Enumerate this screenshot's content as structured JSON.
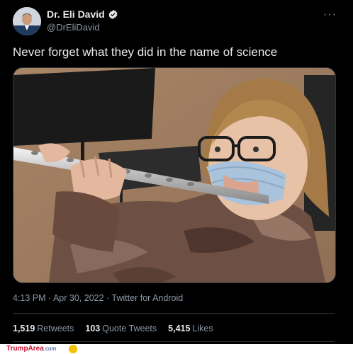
{
  "author": {
    "name": "Dr. Eli David",
    "handle": "@DrEliDavid"
  },
  "tweet": {
    "text": "Never forget what they did in the name of science",
    "timestamp": "4:13 PM · Apr 30, 2022 · Twitter for Android"
  },
  "stats": {
    "retweets_count": "1,519",
    "retweets_label": "Retweets",
    "quotes_count": "103",
    "quotes_label": "Quote Tweets",
    "likes_count": "5,415",
    "likes_label": "Likes"
  },
  "more_label": "···",
  "footer": {
    "brand": "TrumpArea",
    "domain": ".com"
  },
  "colors": {
    "accent": "#1d9bf0",
    "background": "#000000",
    "muted": "#8b98a5",
    "brand_red": "#c8102e"
  }
}
